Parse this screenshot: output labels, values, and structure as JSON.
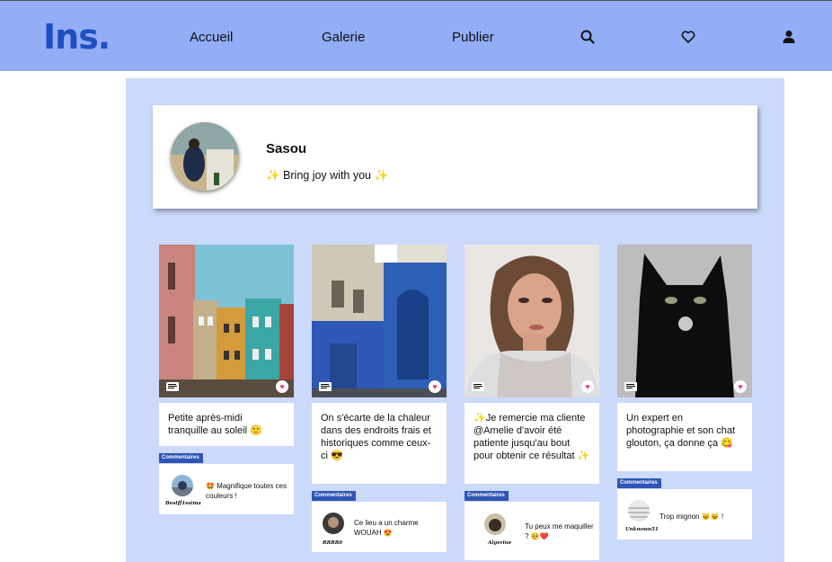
{
  "header": {
    "logo": "Ins.",
    "nav": {
      "home": "Accueil",
      "gallery": "Galerie",
      "publish": "Publier"
    },
    "icons": [
      "search-icon",
      "heart-icon",
      "user-icon"
    ]
  },
  "profile": {
    "username": "Sasou",
    "bio": "✨ Bring joy with you ✨"
  },
  "posts": [
    {
      "caption": "Petite après-midi tranquille au soleil 🙂",
      "comments_label": "Commentaires",
      "comment": {
        "user": "Bestff1ssima",
        "text": "🤩 Magnifique toutes ces couleurs !"
      }
    },
    {
      "caption": "On s'écarte de la chaleur dans des endroits frais et historiques comme ceux-ci 😎",
      "comments_label": "Commentaires",
      "comment": {
        "user": "RRRR0",
        "text": "Ce lieu a un charme WOUAH 😍"
      }
    },
    {
      "caption": "✨Je remercie ma cliente @Amelie d'avoir été patiente jusqu'au bout pour obtenir ce résultat ✨",
      "comments_label": "Commentaires",
      "comment": {
        "user": "Algerine",
        "text": "Tu peux me maquiller ? 🥺❤️"
      }
    },
    {
      "caption": "Un expert en photographie et son chat glouton, ça donne ça 😋",
      "comments_label": "Commentaires",
      "comment": {
        "user": "Unknown51",
        "text": "Trop mignon 🐱🐱 !"
      }
    }
  ],
  "colors": {
    "header": "#93adf7",
    "logo": "#1f4fc0",
    "panel": "#cbd9fb",
    "tag": "#2f55b5"
  }
}
